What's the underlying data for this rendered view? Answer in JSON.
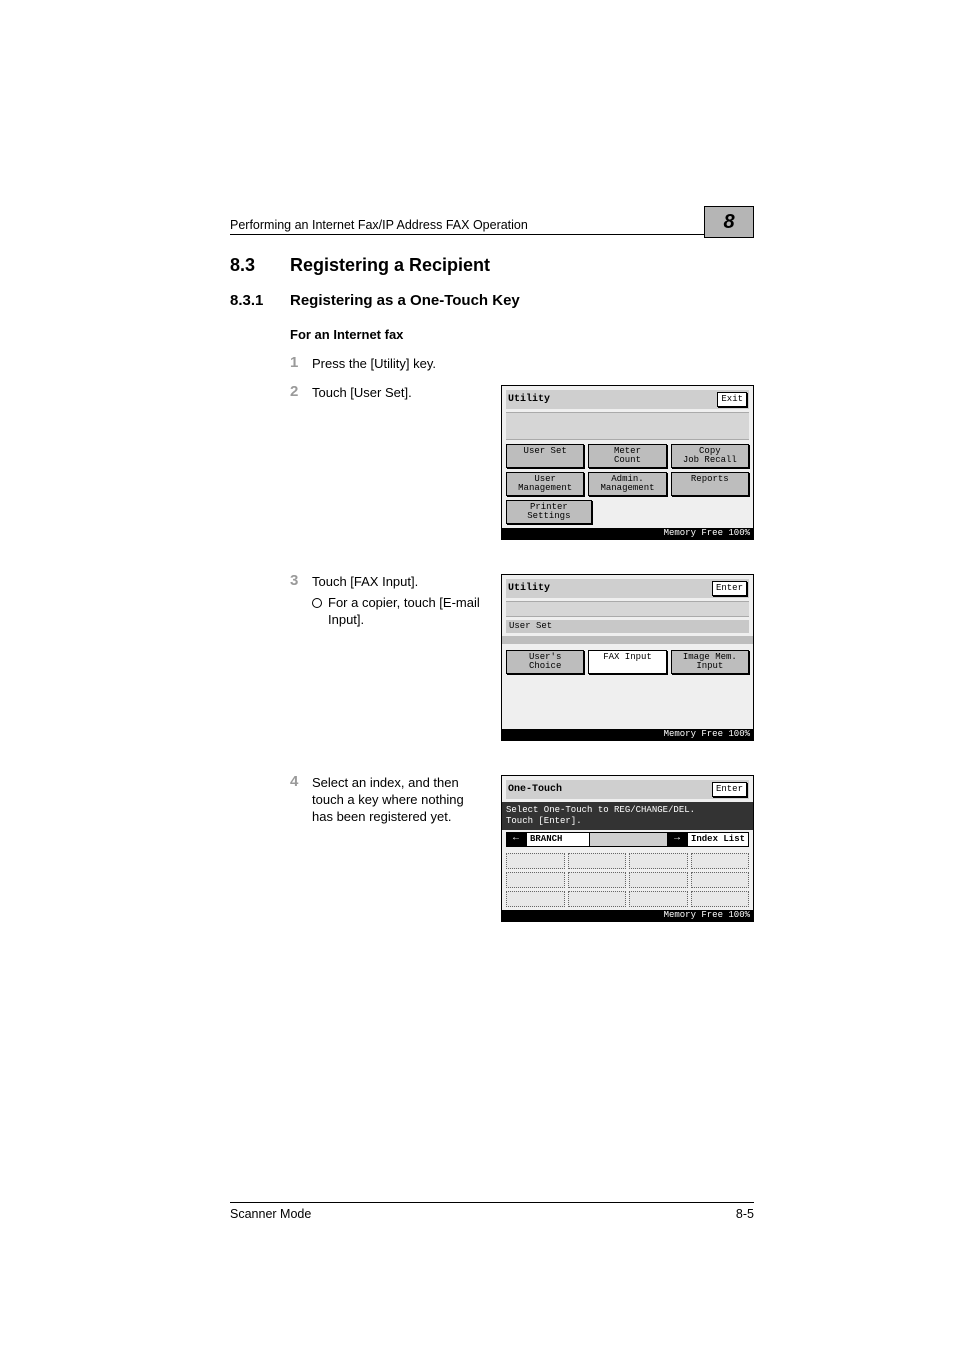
{
  "running_head": "Performing an Internet Fax/IP Address FAX Operation",
  "chapter_tab": "8",
  "sec": {
    "num": "8.3",
    "title": "Registering a Recipient"
  },
  "sub": {
    "num": "8.3.1",
    "title": "Registering as a One-Touch Key"
  },
  "para_title": "For an Internet fax",
  "steps": {
    "s1": "Press the [Utility] key.",
    "s2": "Touch [User Set].",
    "s3": "Touch [FAX Input].",
    "s3_sub": "For a copier, touch [E-mail Input].",
    "s4": "Select an index, and then touch a key where nothing has been registered yet."
  },
  "lcd1": {
    "title": "Utility",
    "exit": "Exit",
    "r1": [
      "User Set",
      "Meter\nCount",
      "Copy\nJob Recall"
    ],
    "r2": [
      "User\nManagement",
      "Admin.\nManagement",
      "Reports"
    ],
    "r3": "Printer\nSettings",
    "footer": "Memory Free 100%"
  },
  "lcd2": {
    "title": "Utility",
    "enter": "Enter",
    "section": "User Set",
    "r1": [
      "User's\nChoice",
      "FAX Input",
      "Image Mem.\nInput"
    ],
    "footer": "Memory Free 100%"
  },
  "lcd3": {
    "title": "One-Touch",
    "enter": "Enter",
    "msg1": "Select One-Touch to REG/CHANGE/DEL.",
    "msg2": "Touch [Enter].",
    "tab": "BRANCH",
    "index": "Index List",
    "footer": "Memory Free 100%"
  },
  "footer": {
    "left": "Scanner Mode",
    "right": "8-5"
  }
}
